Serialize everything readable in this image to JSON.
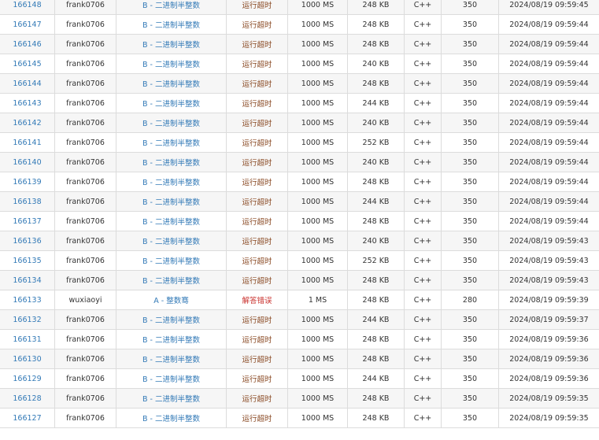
{
  "colors": {
    "link": "#337ab7",
    "time_limit_exceeded": "#8a4a24",
    "wrong_answer": "#c9302c",
    "border": "#dcdcdc",
    "stripe": "#f6f6f6"
  },
  "rows": [
    {
      "id": "166148",
      "user": "frank0706",
      "problem": "B - 二进制半整数",
      "result": "运行超时",
      "result_type": "tle",
      "time": "1000 MS",
      "memory": "248 KB",
      "lang": "C++",
      "length": "350",
      "submit_time": "2024/08/19 09:59:45"
    },
    {
      "id": "166147",
      "user": "frank0706",
      "problem": "B - 二进制半整数",
      "result": "运行超时",
      "result_type": "tle",
      "time": "1000 MS",
      "memory": "248 KB",
      "lang": "C++",
      "length": "350",
      "submit_time": "2024/08/19 09:59:44"
    },
    {
      "id": "166146",
      "user": "frank0706",
      "problem": "B - 二进制半整数",
      "result": "运行超时",
      "result_type": "tle",
      "time": "1000 MS",
      "memory": "248 KB",
      "lang": "C++",
      "length": "350",
      "submit_time": "2024/08/19 09:59:44"
    },
    {
      "id": "166145",
      "user": "frank0706",
      "problem": "B - 二进制半整数",
      "result": "运行超时",
      "result_type": "tle",
      "time": "1000 MS",
      "memory": "240 KB",
      "lang": "C++",
      "length": "350",
      "submit_time": "2024/08/19 09:59:44"
    },
    {
      "id": "166144",
      "user": "frank0706",
      "problem": "B - 二进制半整数",
      "result": "运行超时",
      "result_type": "tle",
      "time": "1000 MS",
      "memory": "248 KB",
      "lang": "C++",
      "length": "350",
      "submit_time": "2024/08/19 09:59:44"
    },
    {
      "id": "166143",
      "user": "frank0706",
      "problem": "B - 二进制半整数",
      "result": "运行超时",
      "result_type": "tle",
      "time": "1000 MS",
      "memory": "244 KB",
      "lang": "C++",
      "length": "350",
      "submit_time": "2024/08/19 09:59:44"
    },
    {
      "id": "166142",
      "user": "frank0706",
      "problem": "B - 二进制半整数",
      "result": "运行超时",
      "result_type": "tle",
      "time": "1000 MS",
      "memory": "240 KB",
      "lang": "C++",
      "length": "350",
      "submit_time": "2024/08/19 09:59:44"
    },
    {
      "id": "166141",
      "user": "frank0706",
      "problem": "B - 二进制半整数",
      "result": "运行超时",
      "result_type": "tle",
      "time": "1000 MS",
      "memory": "252 KB",
      "lang": "C++",
      "length": "350",
      "submit_time": "2024/08/19 09:59:44"
    },
    {
      "id": "166140",
      "user": "frank0706",
      "problem": "B - 二进制半整数",
      "result": "运行超时",
      "result_type": "tle",
      "time": "1000 MS",
      "memory": "240 KB",
      "lang": "C++",
      "length": "350",
      "submit_time": "2024/08/19 09:59:44"
    },
    {
      "id": "166139",
      "user": "frank0706",
      "problem": "B - 二进制半整数",
      "result": "运行超时",
      "result_type": "tle",
      "time": "1000 MS",
      "memory": "248 KB",
      "lang": "C++",
      "length": "350",
      "submit_time": "2024/08/19 09:59:44"
    },
    {
      "id": "166138",
      "user": "frank0706",
      "problem": "B - 二进制半整数",
      "result": "运行超时",
      "result_type": "tle",
      "time": "1000 MS",
      "memory": "244 KB",
      "lang": "C++",
      "length": "350",
      "submit_time": "2024/08/19 09:59:44"
    },
    {
      "id": "166137",
      "user": "frank0706",
      "problem": "B - 二进制半整数",
      "result": "运行超时",
      "result_type": "tle",
      "time": "1000 MS",
      "memory": "248 KB",
      "lang": "C++",
      "length": "350",
      "submit_time": "2024/08/19 09:59:44"
    },
    {
      "id": "166136",
      "user": "frank0706",
      "problem": "B - 二进制半整数",
      "result": "运行超时",
      "result_type": "tle",
      "time": "1000 MS",
      "memory": "240 KB",
      "lang": "C++",
      "length": "350",
      "submit_time": "2024/08/19 09:59:43"
    },
    {
      "id": "166135",
      "user": "frank0706",
      "problem": "B - 二进制半整数",
      "result": "运行超时",
      "result_type": "tle",
      "time": "1000 MS",
      "memory": "252 KB",
      "lang": "C++",
      "length": "350",
      "submit_time": "2024/08/19 09:59:43"
    },
    {
      "id": "166134",
      "user": "frank0706",
      "problem": "B - 二进制半整数",
      "result": "运行超时",
      "result_type": "tle",
      "time": "1000 MS",
      "memory": "248 KB",
      "lang": "C++",
      "length": "350",
      "submit_time": "2024/08/19 09:59:43"
    },
    {
      "id": "166133",
      "user": "wuxiaoyi",
      "problem": "A - 整数骞",
      "result": "解答错误",
      "result_type": "wa",
      "time": "1 MS",
      "memory": "248 KB",
      "lang": "C++",
      "length": "280",
      "submit_time": "2024/08/19 09:59:39"
    },
    {
      "id": "166132",
      "user": "frank0706",
      "problem": "B - 二进制半整数",
      "result": "运行超时",
      "result_type": "tle",
      "time": "1000 MS",
      "memory": "244 KB",
      "lang": "C++",
      "length": "350",
      "submit_time": "2024/08/19 09:59:37"
    },
    {
      "id": "166131",
      "user": "frank0706",
      "problem": "B - 二进制半整数",
      "result": "运行超时",
      "result_type": "tle",
      "time": "1000 MS",
      "memory": "248 KB",
      "lang": "C++",
      "length": "350",
      "submit_time": "2024/08/19 09:59:36"
    },
    {
      "id": "166130",
      "user": "frank0706",
      "problem": "B - 二进制半整数",
      "result": "运行超时",
      "result_type": "tle",
      "time": "1000 MS",
      "memory": "248 KB",
      "lang": "C++",
      "length": "350",
      "submit_time": "2024/08/19 09:59:36"
    },
    {
      "id": "166129",
      "user": "frank0706",
      "problem": "B - 二进制半整数",
      "result": "运行超时",
      "result_type": "tle",
      "time": "1000 MS",
      "memory": "244 KB",
      "lang": "C++",
      "length": "350",
      "submit_time": "2024/08/19 09:59:36"
    },
    {
      "id": "166128",
      "user": "frank0706",
      "problem": "B - 二进制半整数",
      "result": "运行超时",
      "result_type": "tle",
      "time": "1000 MS",
      "memory": "248 KB",
      "lang": "C++",
      "length": "350",
      "submit_time": "2024/08/19 09:59:35"
    },
    {
      "id": "166127",
      "user": "frank0706",
      "problem": "B - 二进制半整数",
      "result": "运行超时",
      "result_type": "tle",
      "time": "1000 MS",
      "memory": "248 KB",
      "lang": "C++",
      "length": "350",
      "submit_time": "2024/08/19 09:59:35"
    }
  ]
}
